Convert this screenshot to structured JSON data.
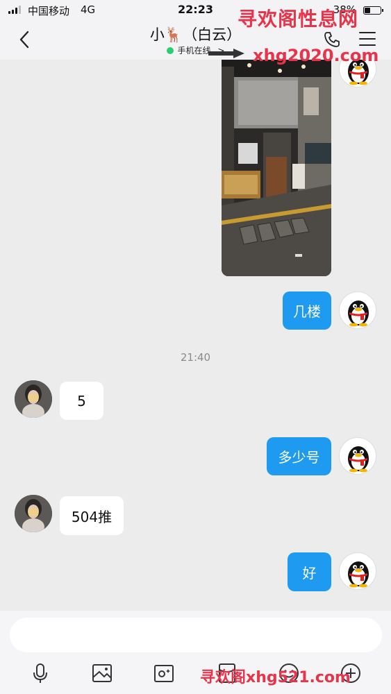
{
  "status_bar": {
    "carrier": "中国移动",
    "network": "4G",
    "time": "22:23",
    "battery": "38%"
  },
  "nav": {
    "title": "小🦌（白云）",
    "presence": "手机在线",
    "presence_chevron": ">"
  },
  "chat": {
    "time_divider": "21:40",
    "messages": [
      {
        "from": "self",
        "type": "image"
      },
      {
        "from": "self",
        "text": "几楼"
      },
      {
        "from": "peer",
        "text": "5"
      },
      {
        "from": "self",
        "text": "多少号"
      },
      {
        "from": "peer",
        "text": "504推"
      },
      {
        "from": "self",
        "text": "好"
      }
    ]
  },
  "input": {
    "placeholder": ""
  },
  "toolbar": {
    "icons": [
      "microphone-icon",
      "image-icon",
      "camera-icon",
      "red-packet-icon",
      "emoji-icon",
      "more-icon"
    ]
  },
  "watermarks": {
    "top": "寻欢阁性息网",
    "top_url": "xhg2020.com",
    "bottom": "寻欢阁xhg521.com"
  },
  "colors": {
    "bubble_out": "#1e9bf0",
    "bubble_in": "#ffffff",
    "online_dot": "#2ecc71",
    "watermark": "#e8344b",
    "background": "#ececec"
  }
}
